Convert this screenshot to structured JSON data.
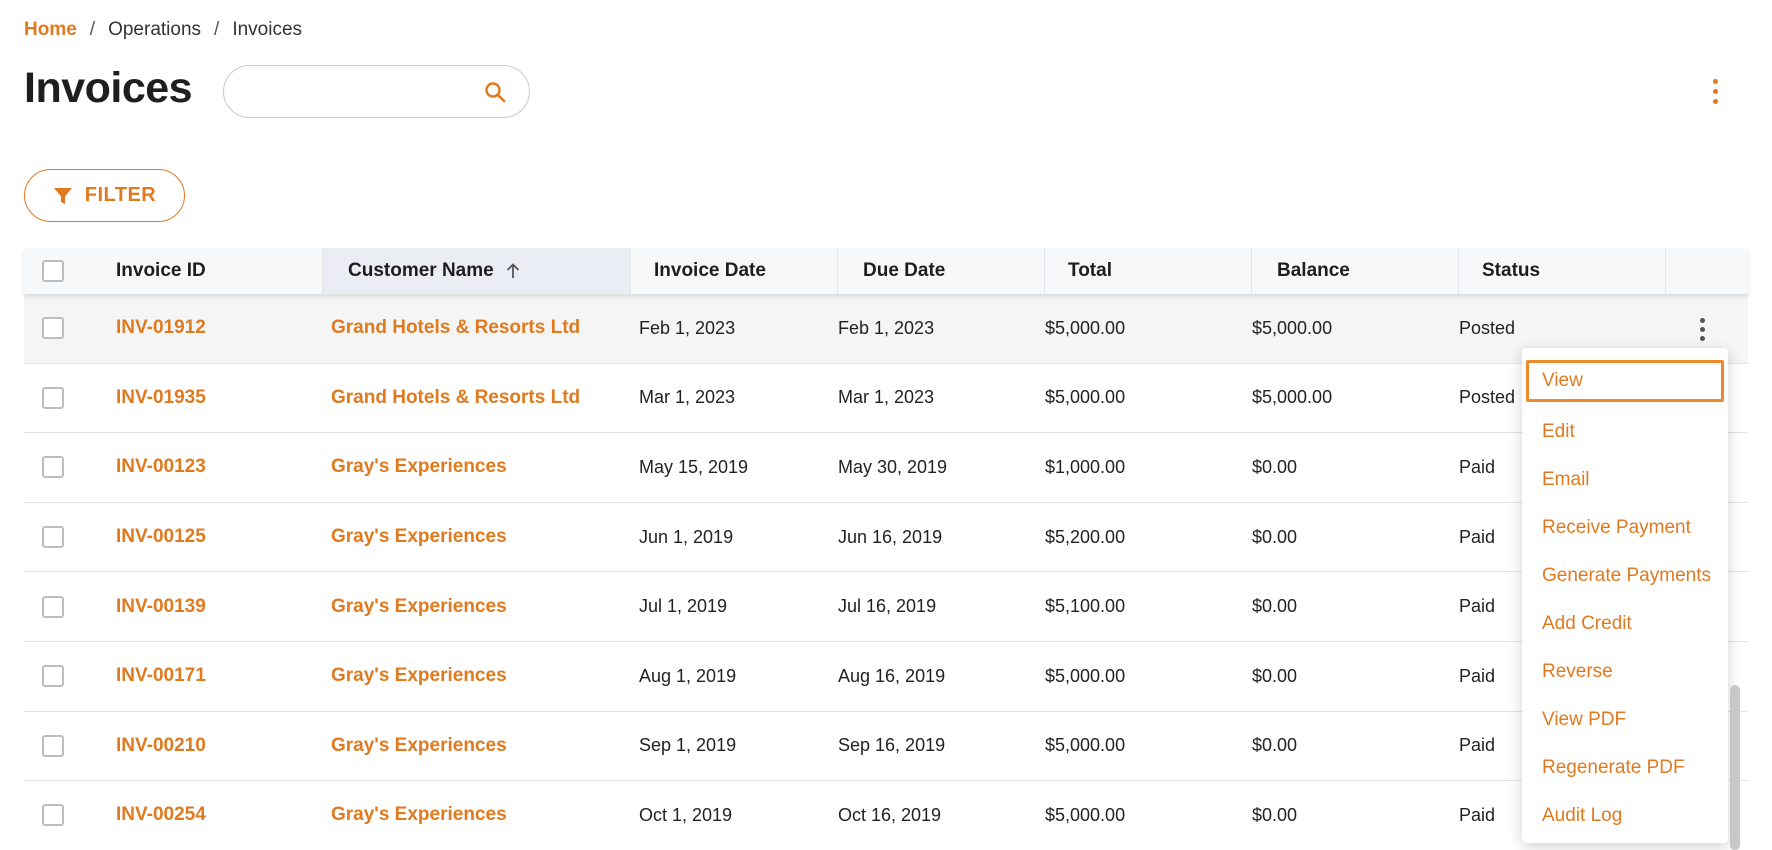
{
  "breadcrumb": {
    "home": "Home",
    "sep1": "/",
    "section": "Operations",
    "sep2": "/",
    "current": "Invoices"
  },
  "page": {
    "title": "Invoices"
  },
  "search": {
    "value": "",
    "placeholder": ""
  },
  "toolbar": {
    "filter_label": "FILTER"
  },
  "colors": {
    "accent": "#e07a1f"
  },
  "table": {
    "headers": {
      "invoice_id": "Invoice ID",
      "customer_name": "Customer Name",
      "invoice_date": "Invoice Date",
      "due_date": "Due Date",
      "total": "Total",
      "balance": "Balance",
      "status": "Status"
    },
    "sort": {
      "column": "customer_name",
      "direction": "ascending"
    },
    "rows": [
      {
        "id": "INV-01912",
        "customer": "Grand Hotels & Resorts Ltd",
        "invoice_date": "Feb 1, 2023",
        "due_date": "Feb 1, 2023",
        "total": "$5,000.00",
        "balance": "$5,000.00",
        "status": "Posted"
      },
      {
        "id": "INV-01935",
        "customer": "Grand Hotels & Resorts Ltd",
        "invoice_date": "Mar 1, 2023",
        "due_date": "Mar 1, 2023",
        "total": "$5,000.00",
        "balance": "$5,000.00",
        "status": "Posted"
      },
      {
        "id": "INV-00123",
        "customer": "Gray's Experiences",
        "invoice_date": "May 15, 2019",
        "due_date": "May 30, 2019",
        "total": "$1,000.00",
        "balance": "$0.00",
        "status": "Paid"
      },
      {
        "id": "INV-00125",
        "customer": "Gray's Experiences",
        "invoice_date": "Jun 1, 2019",
        "due_date": "Jun 16, 2019",
        "total": "$5,200.00",
        "balance": "$0.00",
        "status": "Paid"
      },
      {
        "id": "INV-00139",
        "customer": "Gray's Experiences",
        "invoice_date": "Jul 1, 2019",
        "due_date": "Jul 16, 2019",
        "total": "$5,100.00",
        "balance": "$0.00",
        "status": "Paid"
      },
      {
        "id": "INV-00171",
        "customer": "Gray's Experiences",
        "invoice_date": "Aug 1, 2019",
        "due_date": "Aug 16, 2019",
        "total": "$5,000.00",
        "balance": "$0.00",
        "status": "Paid"
      },
      {
        "id": "INV-00210",
        "customer": "Gray's Experiences",
        "invoice_date": "Sep 1, 2019",
        "due_date": "Sep 16, 2019",
        "total": "$5,000.00",
        "balance": "$0.00",
        "status": "Paid"
      },
      {
        "id": "INV-00254",
        "customer": "Gray's Experiences",
        "invoice_date": "Oct 1, 2019",
        "due_date": "Oct 16, 2019",
        "total": "$5,000.00",
        "balance": "$0.00",
        "status": "Paid"
      }
    ]
  },
  "row_menu": {
    "items": [
      {
        "label": "View",
        "focused": true
      },
      {
        "label": "Edit"
      },
      {
        "label": "Email"
      },
      {
        "label": "Receive Payment"
      },
      {
        "label": "Generate Payments"
      },
      {
        "label": "Add Credit"
      },
      {
        "label": "Reverse"
      },
      {
        "label": "View PDF"
      },
      {
        "label": "Regenerate PDF"
      },
      {
        "label": "Audit Log"
      }
    ]
  }
}
